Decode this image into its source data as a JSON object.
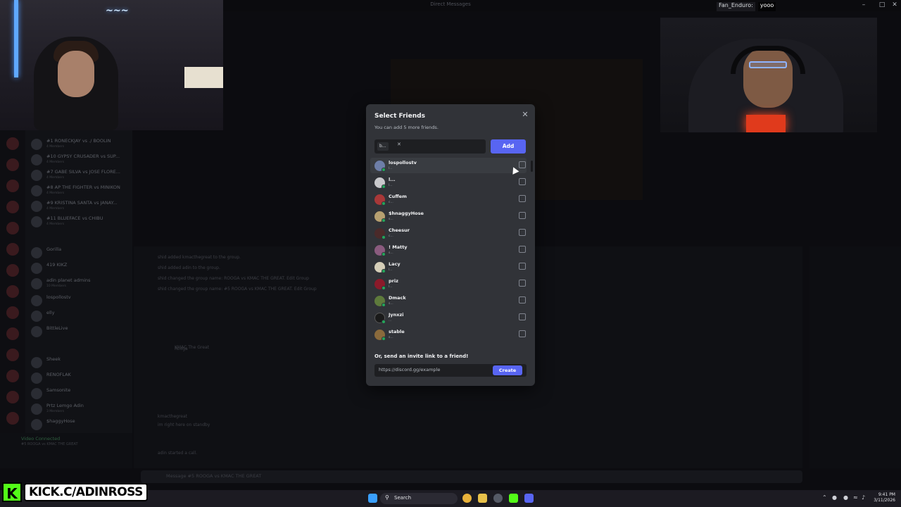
{
  "window": {
    "title": "Direct Messages"
  },
  "stream_chat": {
    "user": "Fan_Enduro:",
    "message": "yooo"
  },
  "background_dms": [
    {
      "name": "#1 RONECKJAY vs ./ BOOLIN",
      "sub": "4 Members"
    },
    {
      "name": "#10 GYPSY CRUSADER vs SUP...",
      "sub": "4 Members"
    },
    {
      "name": "#7 GABE SILVA vs JOSE FLORE...",
      "sub": "4 Members"
    },
    {
      "name": "#8 AP THE FIGHTER vs MINIKON",
      "sub": "4 Members"
    },
    {
      "name": "#9 KRISTINA SANTA vs JANAY...",
      "sub": "4 Members"
    },
    {
      "name": "#11 BLUEFACE vs CHIBU",
      "sub": "4 Members"
    },
    {
      "name": "Gorilla",
      "sub": ""
    },
    {
      "name": "419 KIKZ",
      "sub": ""
    },
    {
      "name": "adin planet admins",
      "sub": "10 Members"
    },
    {
      "name": "lospollostv",
      "sub": ""
    },
    {
      "name": "elly",
      "sub": ""
    },
    {
      "name": "BittleLive",
      "sub": ""
    },
    {
      "name": "Sheek",
      "sub": ""
    },
    {
      "name": "RENOFLAK",
      "sub": ""
    },
    {
      "name": "Samsonite",
      "sub": ""
    },
    {
      "name": "Prtz Lemgo Adin",
      "sub": "3 Members"
    },
    {
      "name": "$haggyHose",
      "sub": ""
    }
  ],
  "background_chat": [
    "shid added kmacthegreat to the group.",
    "shid added adin to the group.",
    "shid changed the group name: ROOGA vs KMAC THE GREAT. Edit Group",
    "shid changed the group name: #5 ROOGA vs KMAC THE GREAT. Edit Group",
    "Rooga",
    "KMAC The Great",
    "kmacthegreat",
    "im right here on standby",
    "adin started a call."
  ],
  "voice": {
    "status": "Video Connected",
    "channel": "#5 ROOGA vs KMAC THE GREAT"
  },
  "message_placeholder": "Message #5 ROOGA vs KMAC THE GREAT",
  "modal": {
    "title": "Select Friends",
    "subtitle": "You can add 5 more friends.",
    "chip": "b...",
    "add_label": "Add",
    "friends": [
      {
        "name": "lospollostv",
        "sub": "l...",
        "color": "#6d7ea8"
      },
      {
        "name": "l...",
        "sub": "l...",
        "color": "#c9c9cc"
      },
      {
        "name": "Cuffem",
        "sub": "c...",
        "color": "#a83838"
      },
      {
        "name": "$hnaggyHose",
        "sub": "s...",
        "color": "#b7a070"
      },
      {
        "name": "Cheesur",
        "sub": "c...",
        "color": "#4a2a2a"
      },
      {
        "name": "! Matty",
        "sub": "s...",
        "color": "#8a5b7e"
      },
      {
        "name": "Lacy",
        "sub": "l...",
        "color": "#d5ceb8"
      },
      {
        "name": "priz",
        "sub": "l...",
        "color": "#8b1a2a"
      },
      {
        "name": "Dmack",
        "sub": "s...",
        "color": "#5e7a3c"
      },
      {
        "name": "Jynxzi",
        "sub": "...",
        "color": "#1a1a1a"
      },
      {
        "name": "stable",
        "sub": "s...",
        "color": "#8a6a3c"
      }
    ],
    "invite_label": "Or, send an invite link to a friend!",
    "invite_link": "https://discord.gg/example",
    "create_label": "Create"
  },
  "taskbar": {
    "search": "Search",
    "time": "9:41 PM",
    "date": "3/11/2026"
  },
  "overlay": {
    "kick_text": "KICK.C/ADINROSS"
  },
  "colors": {
    "accent": "#5865f2",
    "modal_bg": "#313338",
    "kick": "#53fc18"
  }
}
